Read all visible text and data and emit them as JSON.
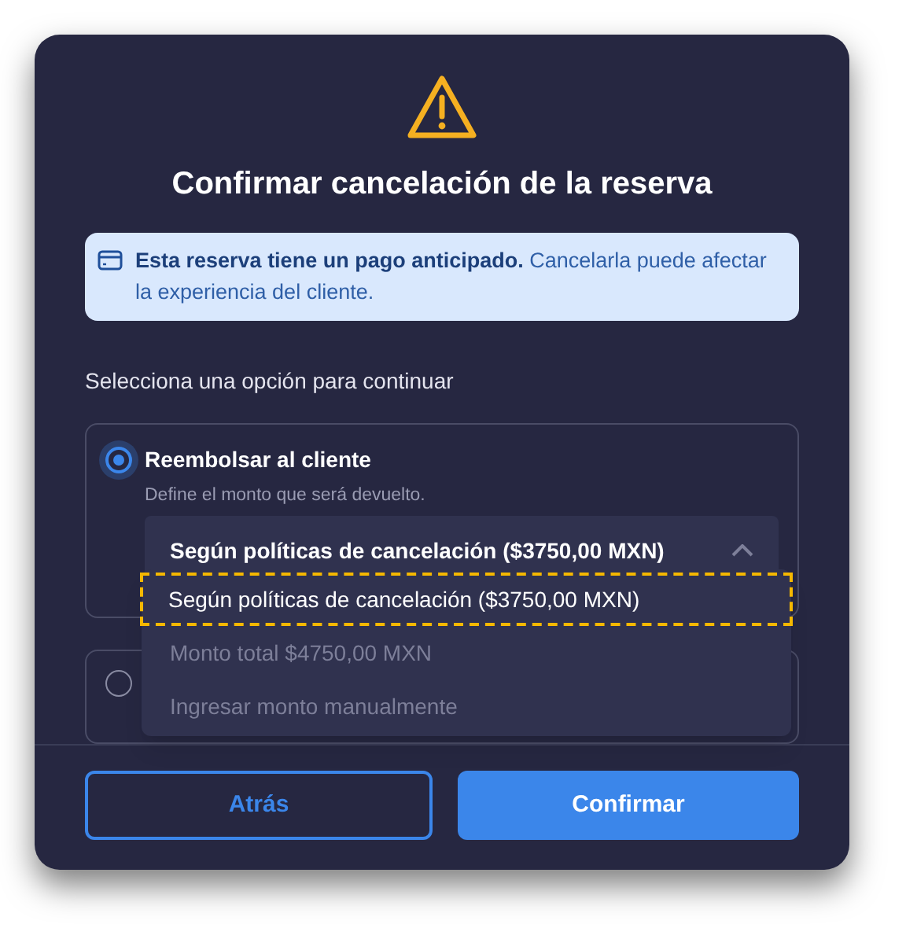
{
  "dialog": {
    "title": "Confirmar cancelación de la reserva",
    "notice": "**Esta reserva tiene un pago anticipado.** Cancelarla puede afectar la experiencia del cliente.",
    "prompt": "Selecciona una opción para continuar",
    "options": [
      {
        "label": "Reembolsar al cliente",
        "description": "Define el monto que será devuelto.",
        "selected": true
      },
      {
        "selected": false
      }
    ],
    "amount_select": {
      "value": "Según políticas de cancelación ($3750,00 MXN)",
      "expanded": true,
      "menu": [
        {
          "label": "Según políticas de cancelación ($3750,00 MXN)",
          "selected": true
        },
        {
          "label": "Monto total $4750,00 MXN",
          "selected": false
        },
        {
          "label": "Ingresar monto manualmente",
          "selected": false
        }
      ]
    },
    "buttons": [
      {
        "label": "Atrás",
        "kind": "secondary"
      },
      {
        "label": "Confirmar",
        "kind": "primary"
      }
    ]
  }
}
